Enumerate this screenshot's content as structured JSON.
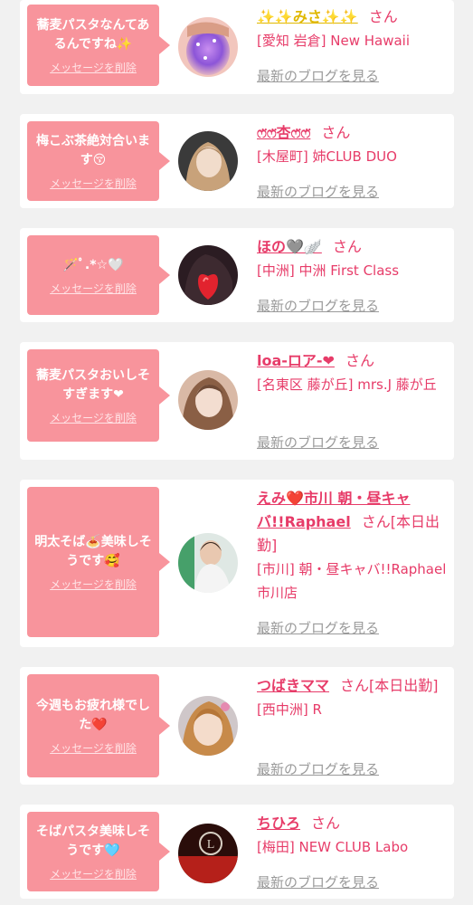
{
  "cards": [
    {
      "message": "蕎麦パスタなんてあるんですね✨",
      "delete_label": "メッセージを削除",
      "name": "✨✨みさ✨✨",
      "suffix": "さん",
      "shop": "[愛知 岩倉] New Hawaii",
      "blog_label": "最新のブログを見る",
      "avatar_icon": "user-photo-icon"
    },
    {
      "message": "梅こぶ茶絶対合います😚",
      "delete_label": "メッセージを削除",
      "name": "ෆ̈ෆ̈杏ෆ̈ෆ̈",
      "suffix": "さん",
      "shop": "[木屋町] 姉CLUB DUO",
      "blog_label": "最新のブログを見る",
      "avatar_icon": "user-photo-icon"
    },
    {
      "message": "🪄ﾟ.*☆🤍",
      "delete_label": "メッセージを削除",
      "name": "ほの🩶🪽",
      "suffix": "さん",
      "shop": "[中洲] 中洲 First Class",
      "blog_label": "最新のブログを見る",
      "avatar_icon": "user-photo-icon"
    },
    {
      "message": "蕎麦パスタおいしそすぎます❤",
      "delete_label": "メッセージを削除",
      "name": "loa-ロア-❤",
      "suffix": "さん",
      "shop": "[名東区 藤が丘] mrs.J 藤が丘",
      "blog_label": "最新のブログを見る",
      "avatar_icon": "user-photo-icon"
    },
    {
      "message": "明太そば🍝美味しそうです🥰",
      "delete_label": "メッセージを削除",
      "name": "えみ❤️市川 朝・昼キャバ!!Raphael",
      "suffix": "さん[本日出勤]",
      "shop": "[市川] 朝・昼キャバ!!Raphael 市川店",
      "blog_label": "最新のブログを見る",
      "avatar_icon": "user-photo-icon"
    },
    {
      "message": "今週もお疲れ様でした❤️",
      "delete_label": "メッセージを削除",
      "name": "つばきママ",
      "suffix": "さん[本日出勤]",
      "shop": "[西中洲] R",
      "blog_label": "最新のブログを見る",
      "avatar_icon": "user-photo-icon"
    },
    {
      "message": "そばパスタ美味しそうです🩵",
      "delete_label": "メッセージを削除",
      "name": "ちひろ",
      "suffix": "さん",
      "shop": "[梅田] NEW CLUB Labo",
      "blog_label": "最新のブログを見る",
      "avatar_icon": "user-photo-icon"
    }
  ],
  "colors": {
    "bubble": "#f8949c",
    "accent": "#e73c69",
    "link_gray": "#9a9a9a",
    "background": "#f1f1f1"
  }
}
